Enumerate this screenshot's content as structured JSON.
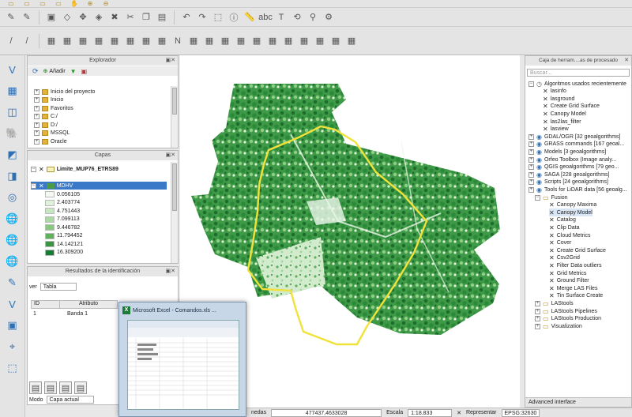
{
  "left_panels": {
    "explorer": {
      "title": "Explorador",
      "add_label": "Añadir",
      "items": [
        "Inicio del proyecto",
        "Inicio",
        "Favoritos",
        "C:/",
        "D:/",
        "MSSQL",
        "Oracle"
      ]
    },
    "layers": {
      "title": "Capas",
      "layer1": "Limite_MUP76_ETRS89",
      "layer2": "MDHV",
      "legend_values": [
        "0.056105",
        "2.403774",
        "4.751443",
        "7.099113",
        "9.446782",
        "11.794452",
        "14.142121",
        "16.309200"
      ],
      "legend_colors": [
        "#f4faf2",
        "#dff0db",
        "#c7e6c1",
        "#aad9a2",
        "#87c880",
        "#5fb15c",
        "#3a9441",
        "#1a7a33"
      ]
    },
    "identify": {
      "title": "Resultados de la identificación",
      "viewer_label": "ver",
      "viewer_value": "Tabla",
      "col_id": "ID",
      "col_attr": "Atributo",
      "row_id": "1",
      "row_attr": "Banda 1"
    },
    "mode_label": "Modo",
    "mode_value": "Capa actual"
  },
  "excel_window": {
    "title": "Microsoft Excel - Comandos.xls ..."
  },
  "status": {
    "coord_label": "nedas",
    "coordinates": "477437,4633028",
    "scale_label": "Escala",
    "scale_value": "1:18.833",
    "render_label": "Representar",
    "crs": "EPSG:32630"
  },
  "toolbox": {
    "title": "Caja de herram....as de procesado",
    "search_placeholder": "Buscar...",
    "recent_header": "Algoritmos usados recientemente",
    "recent": [
      "lasinfo",
      "lasground",
      "Create Grid Surface",
      "Canopy Model",
      "las2las_filter",
      "lasview"
    ],
    "providers": [
      "GDAL/OGR [32 geoalgorithms]",
      "GRASS commands [167 geoal...",
      "Models [3 geoalgorithms]",
      "Orfeo Toolbox (Image analy...",
      "QGIS geoalgorithms [79 geo...",
      "SAGA [228 geoalgorithms]",
      "Scripts [24 geoalgorithms]",
      "Tools for LiDAR data [56 geoalg..."
    ],
    "fusion_header": "Fusion",
    "fusion": [
      "Canopy Maxima",
      "Canopy Model",
      "Catalog",
      "Clip Data",
      "Cloud Metrics",
      "Cover",
      "Create Grid Surface",
      "Csv2Grid",
      "Filter Data outliers",
      "Grid Metrics",
      "Ground Filter",
      "Merge LAS Files",
      "Tin Surface Create"
    ],
    "other": [
      "LAStools",
      "LAStools Pipelines",
      "LAStools Production",
      "Visualization"
    ],
    "footer": "Advanced interface"
  },
  "accent": "#2f6fb3",
  "map_boundary_color": "#f0e23a"
}
